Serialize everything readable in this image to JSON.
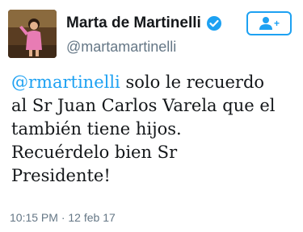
{
  "tweet": {
    "author": {
      "display_name": "Marta de Martinelli",
      "handle": "@martamartinelli",
      "verified": true,
      "avatar_icon": "profile-photo"
    },
    "follow_button": {
      "icon": "add-user-icon",
      "plus": "+"
    },
    "mention": "@rmartinelli",
    "text_lines": [
      " solo le recuerdo",
      "al Sr Juan Carlos Varela que el",
      "también tiene hijos.",
      "Recuérdelo bien Sr",
      "Presidente!"
    ],
    "time": "10:15 PM",
    "separator": "·",
    "date": "12 feb 17"
  },
  "colors": {
    "accent": "#1da1f2",
    "text": "#14171a",
    "muted": "#657786"
  }
}
